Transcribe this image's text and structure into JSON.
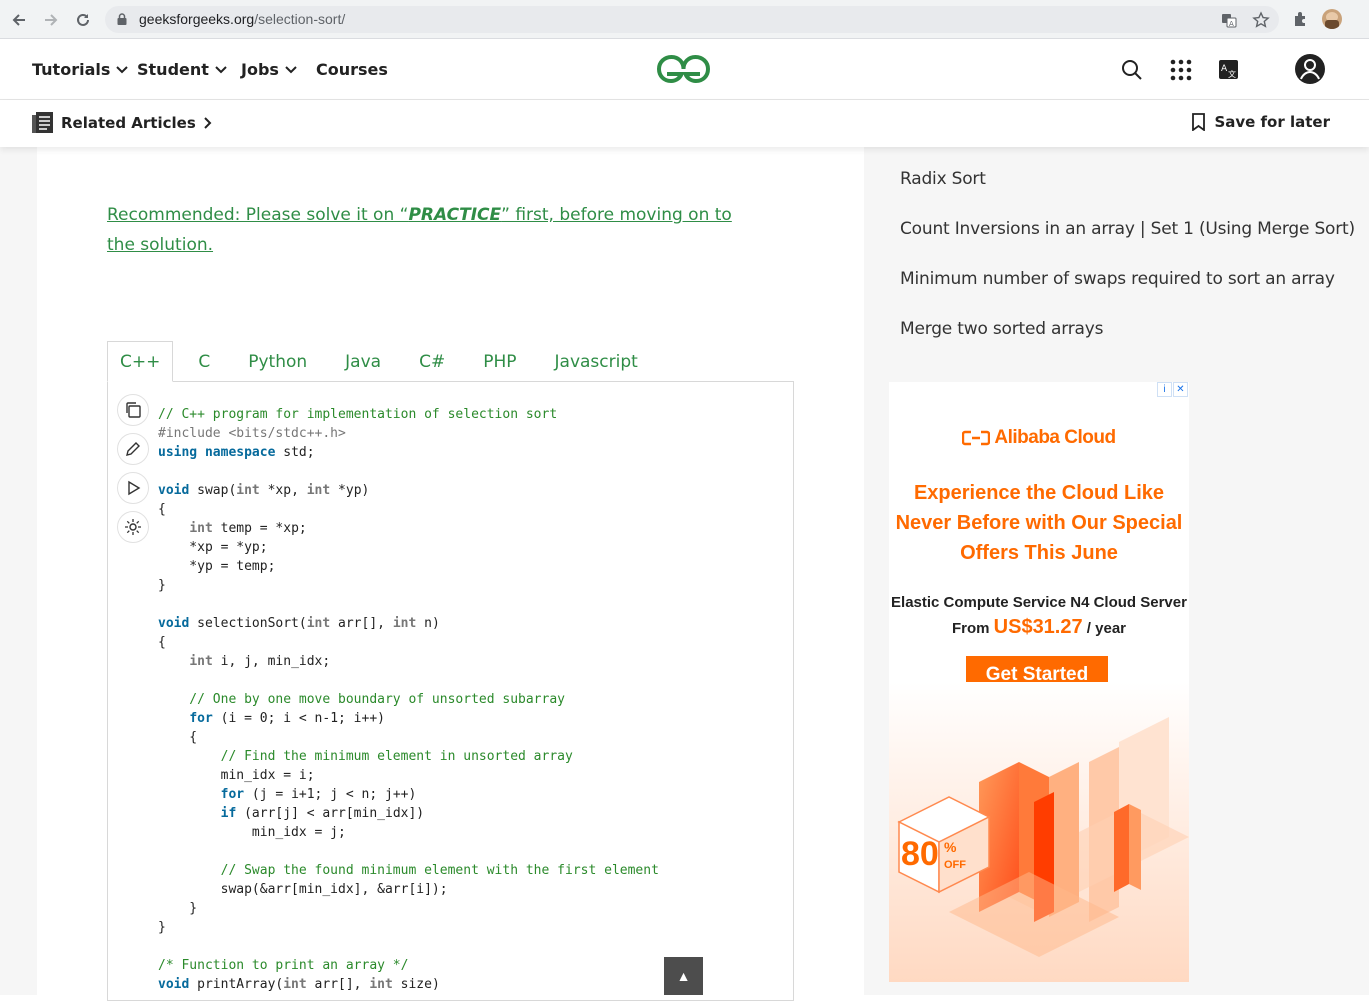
{
  "browser": {
    "url_host": "geeksforgeeks.org",
    "url_path": "/selection-sort/"
  },
  "header": {
    "nav": [
      {
        "label": "Tutorials",
        "dropdown": true
      },
      {
        "label": "Student",
        "dropdown": true
      },
      {
        "label": "Jobs",
        "dropdown": true
      },
      {
        "label": "Courses",
        "dropdown": false
      }
    ],
    "brand_color": "#2f8d46"
  },
  "subheader": {
    "related_label": "Related Articles",
    "save_label": "Save for later"
  },
  "article": {
    "recommend_prefix": "Recommended: Please solve it on “",
    "recommend_emph": "PRACTICE",
    "recommend_suffix": "” first, before moving on to the solution.",
    "tabs": [
      "C++",
      "C",
      "Python",
      "Java",
      "C#",
      "PHP",
      "Javascript"
    ],
    "active_tab": "C++",
    "code_lines": [
      "// C++ program for implementation of selection sort",
      "#include <bits/stdc++.h>",
      "using namespace std;",
      "",
      "void swap(int *xp, int *yp)",
      "{",
      "    int temp = *xp;",
      "    *xp = *yp;",
      "    *yp = temp;",
      "}",
      "",
      "void selectionSort(int arr[], int n)",
      "{",
      "    int i, j, min_idx;",
      "",
      "    // One by one move boundary of unsorted subarray",
      "    for (i = 0; i < n-1; i++)",
      "    {",
      "        // Find the minimum element in unsorted array",
      "        min_idx = i;",
      "        for (j = i+1; j < n; j++)",
      "        if (arr[j] < arr[min_idx])",
      "            min_idx = j;",
      "",
      "        // Swap the found minimum element with the first element",
      "        swap(&arr[min_idx], &arr[i]);",
      "    }",
      "}",
      "",
      "/* Function to print an array */",
      "void printArray(int arr[], int size)"
    ],
    "scroll_top_label": "▲"
  },
  "sidebar": {
    "links": [
      "Radix Sort",
      "Count Inversions in an array | Set 1 (Using Merge Sort)",
      "Minimum number of swaps required to sort an array",
      "Merge two sorted arrays"
    ]
  },
  "ad": {
    "brand": "Alibaba Cloud",
    "headline_lines": [
      "Experience the Cloud Like",
      "Never Before with Our Special",
      "Offers This June"
    ],
    "sub_line1": "Elastic Compute Service N4 Cloud Server",
    "sub_from": "From",
    "price": "US$31.27",
    "per": "/ year",
    "cta": "Get Started",
    "badge_num": "80",
    "badge_pct": "%",
    "badge_off": "OFF",
    "accent": "#ff6a00"
  }
}
